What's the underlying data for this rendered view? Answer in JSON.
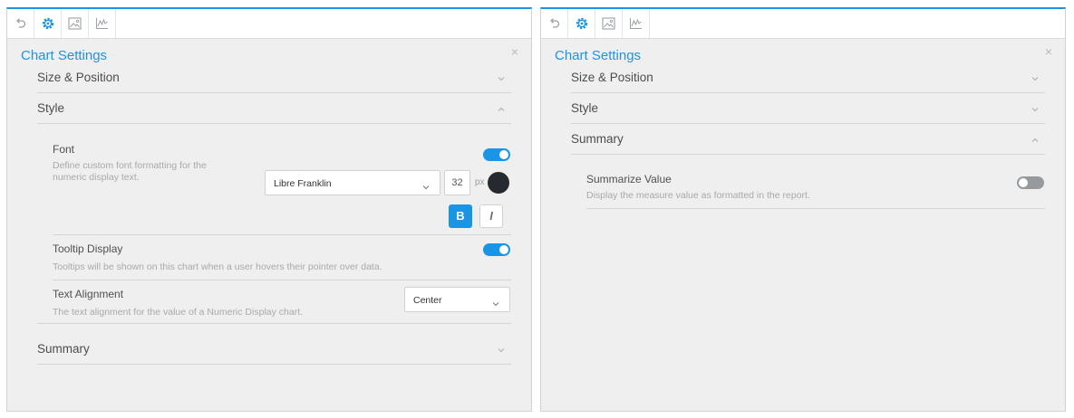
{
  "left_panel": {
    "toolbar": {
      "icons": [
        "undo-icon",
        "gear-icon",
        "image-icon",
        "line-chart-icon"
      ]
    },
    "title": "Chart Settings",
    "close": "×",
    "sections": {
      "size_position": "Size & Position",
      "style": "Style",
      "summary": "Summary"
    },
    "font": {
      "title": "Font",
      "desc_line1": "Define custom font formatting for the",
      "desc_line2": "numeric display text.",
      "enabled": true,
      "family": "Libre Franklin",
      "size": "32",
      "unit": "px",
      "color": "#262a30",
      "bold_label": "B",
      "italic_label": "I",
      "bold_active": true
    },
    "tooltip": {
      "title": "Tooltip Display",
      "desc": "Tooltips will be shown on this chart when a user hovers their pointer over data.",
      "enabled": true
    },
    "alignment": {
      "title": "Text Alignment",
      "desc": "The text alignment for the value of a Numeric Display chart.",
      "value": "Center"
    }
  },
  "right_panel": {
    "toolbar": {
      "icons": [
        "undo-icon",
        "gear-icon",
        "image-icon",
        "line-chart-icon"
      ]
    },
    "title": "Chart Settings",
    "close": "×",
    "sections": {
      "size_position": "Size & Position",
      "style": "Style",
      "summary": "Summary"
    },
    "summarize": {
      "title": "Summarize Value",
      "desc": "Display the measure value as formatted in the report.",
      "enabled": false
    }
  },
  "colors": {
    "accent": "#1a95e5",
    "toggle_off": "#979a9d",
    "panel_bg": "#efefef"
  }
}
